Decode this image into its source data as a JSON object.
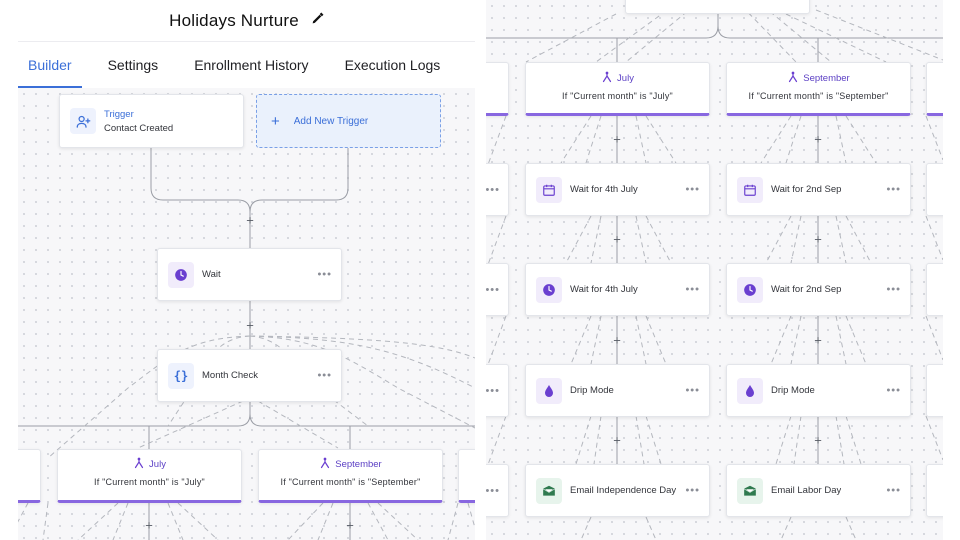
{
  "workflow": {
    "title": "Holidays Nurture",
    "edit_icon": "pencil-icon"
  },
  "tabs": [
    {
      "label": "Builder",
      "active": true
    },
    {
      "label": "Settings",
      "active": false
    },
    {
      "label": "Enrollment History",
      "active": false
    },
    {
      "label": "Execution Logs",
      "active": false
    }
  ],
  "left": {
    "trigger": {
      "title": "Trigger",
      "subtitle": "Contact Created",
      "icon": "user-plus-icon"
    },
    "add_trigger": {
      "label": "Add New Trigger",
      "icon": "plus-icon"
    },
    "wait": {
      "label": "Wait",
      "icon": "clock-icon"
    },
    "month_check": {
      "label": "Month Check",
      "icon": "braces-icon"
    },
    "branches": [
      {
        "name": "July",
        "condition": "If \"Current month\" is \"July\"",
        "icon": "split-icon"
      },
      {
        "name": "September",
        "condition": "If \"Current month\" is \"September\"",
        "icon": "split-icon"
      }
    ]
  },
  "right": {
    "branches": [
      {
        "name": "July",
        "condition": "If \"Current month\" is \"July\""
      },
      {
        "name": "September",
        "condition": "If \"Current month\" is \"September\""
      }
    ],
    "july_steps": [
      {
        "label": "Wait for 4th July",
        "icon": "calendar-icon"
      },
      {
        "label": "Wait for 4th July",
        "icon": "clock-icon"
      },
      {
        "label": "Drip Mode",
        "icon": "drop-icon"
      },
      {
        "label": "Email Independence Day",
        "icon": "email-icon"
      }
    ],
    "september_steps": [
      {
        "label": "Wait for 2nd Sep",
        "icon": "calendar-icon"
      },
      {
        "label": "Wait for 2nd Sep",
        "icon": "clock-icon"
      },
      {
        "label": "Drip Mode",
        "icon": "drop-icon"
      },
      {
        "label": "Email Labor Day",
        "icon": "email-icon"
      }
    ]
  },
  "colors": {
    "accent": "#3b6fd8",
    "branch_accent": "#8867e0",
    "icon_purple": "#6a3fd0",
    "email_green": "#2f7a4f"
  }
}
